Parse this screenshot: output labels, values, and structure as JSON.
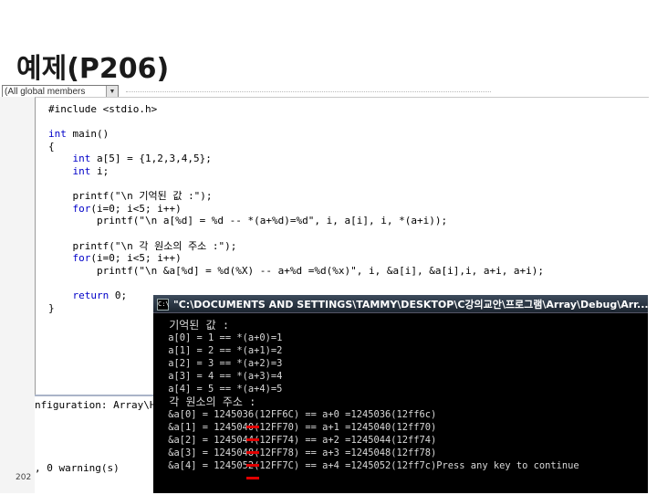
{
  "slide": {
    "title": "예제(P206)",
    "footer_year": "202"
  },
  "toolbar": {
    "scope_combo": "(All global members"
  },
  "code": {
    "lines": [
      "#include <stdio.h>",
      "",
      "int main()",
      "{",
      "    int a[5] = {1,2,3,4,5};",
      "    int i;",
      "",
      "    printf(\"\\n 기억된 값 :\");",
      "    for(i=0; i<5; i++)",
      "        printf(\"\\n a[%d] = %d -- *(a+%d)=%d\", i, a[i], i, *(a+i));",
      "",
      "    printf(\"\\n 각 원소의 주소 :\");",
      "    for(i=0; i<5; i++)",
      "        printf(\"\\n &a[%d] = %d(%X) -- a+%d =%d(%x)\", i, &a[i], &a[i],i, a+i, a+i);",
      "",
      "    return 0;",
      "}"
    ]
  },
  "output_pane": {
    "config_line": "nfiguration: Array\\H",
    "warning_line": ", 0 warning(s)"
  },
  "console": {
    "title": "\"C:\\DOCUMENTS AND SETTINGS\\TAMMY\\DESKTOP\\C강의교안\\프로그램\\Array\\Debug\\Arr...",
    "icon_label": "C:\\",
    "lines": [
      " 기억된 값 :",
      " a[0] = 1 == *(a+0)=1",
      " a[1] = 2 == *(a+1)=2",
      " a[2] = 3 == *(a+2)=3",
      " a[3] = 4 == *(a+3)=4",
      " a[4] = 5 == *(a+4)=5",
      " 각 원소의 주소 :",
      " &a[0] = 1245036(12FF6C) == a+0 =1245036(12ff6c)",
      " &a[1] = 1245040(12FF70) == a+1 =1245040(12ff70)",
      " &a[2] = 1245044(12FF74) == a+2 =1245044(12ff74)",
      " &a[3] = 1245048(12FF78) == a+3 =1245048(12ff78)",
      " &a[4] = 1245052(12FF7C) == a+4 =1245052(12ff7c)Press any key to continue"
    ]
  },
  "colors": {
    "keyword": "#0000c8",
    "console_bg": "#000000",
    "highlight": "#e00000"
  }
}
